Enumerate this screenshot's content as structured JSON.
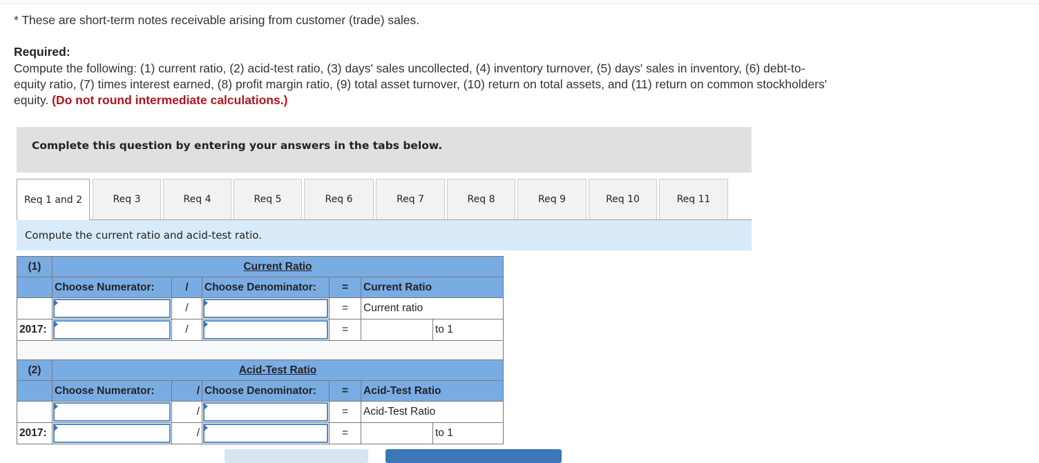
{
  "note": "* These are short-term notes receivable arising from customer (trade) sales.",
  "required": {
    "title": "Required:",
    "text": "Compute the following: (1) current ratio, (2) acid-test ratio, (3) days' sales uncollected, (4) inventory turnover, (5) days' sales in inventory, (6) debt-to-equity ratio, (7) times interest earned, (8) profit margin ratio, (9) total asset turnover, (10) return on total assets, and (11) return on common stockholders' equity.",
    "emphasis": "(Do not round intermediate calculations.)"
  },
  "banner": "Complete this question by entering your answers in the tabs below.",
  "tabs": [
    {
      "label": "Req 1 and 2",
      "active": true
    },
    {
      "label": "Req 3",
      "active": false
    },
    {
      "label": "Req 4",
      "active": false
    },
    {
      "label": "Req 5",
      "active": false
    },
    {
      "label": "Req 6",
      "active": false
    },
    {
      "label": "Req 7",
      "active": false
    },
    {
      "label": "Req 8",
      "active": false
    },
    {
      "label": "Req 9",
      "active": false
    },
    {
      "label": "Req 10",
      "active": false
    },
    {
      "label": "Req 11",
      "active": false
    }
  ],
  "instruction": "Compute the current ratio and acid-test ratio.",
  "current_ratio": {
    "number": "(1)",
    "title": "Current Ratio",
    "numerator_header": "Choose Numerator:",
    "divide_symbol": "/",
    "denominator_header": "Choose Denominator:",
    "equals_symbol": "=",
    "result_header": "Current Ratio",
    "formula_result": "Current ratio",
    "year_label": "2017:",
    "numerator_value": "",
    "denominator_value": "",
    "result_value": "",
    "suffix": "to 1"
  },
  "acid_test_ratio": {
    "number": "(2)",
    "title": "Acid-Test Ratio",
    "numerator_header": "Choose Numerator:",
    "divide_symbol": "/",
    "denominator_header": "Choose Denominator:",
    "equals_symbol": "=",
    "result_header": "Acid-Test Ratio",
    "formula_result": "Acid-Test Ratio",
    "year_label": "2017:",
    "numerator_value": "",
    "denominator_value": "",
    "result_value": "",
    "suffix": "to 1"
  },
  "colors": {
    "header_blue": "#7aace4",
    "input_border": "#4d88c9",
    "instruction_bg": "#d9ebf9",
    "banner_bg": "#e0e0e0",
    "emphasis_red": "#b3141c",
    "next_button": "#3a76b8",
    "prev_button": "#d6e3f1"
  }
}
